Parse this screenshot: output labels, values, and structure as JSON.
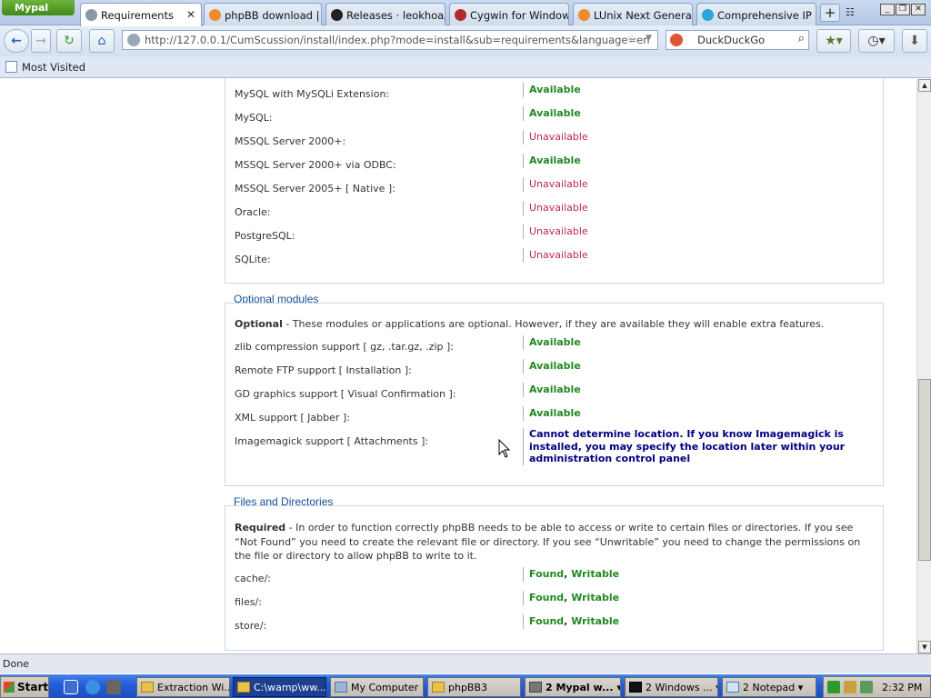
{
  "browser": {
    "app_button": "Mypal",
    "tabs": [
      {
        "label": "Requirements",
        "active": true,
        "icon": "globe-icon"
      },
      {
        "label": "phpBB download | S...",
        "icon": "phpbb-icon"
      },
      {
        "label": "Releases · leokhoa/l...",
        "icon": "github-icon"
      },
      {
        "label": "Cygwin for Windows...",
        "icon": "cygwin-icon"
      },
      {
        "label": "LUnix Next Generati...",
        "icon": "phpbb-icon"
      },
      {
        "label": "Comprehensive IP a...",
        "icon": "location-icon"
      }
    ],
    "new_tab": "+",
    "url": "http://127.0.0.1/CumScussion/install/index.php?mode=install&sub=requirements&language=en",
    "search_placeholder": "DuckDuckGo",
    "bookmarks_label": "Most Visited",
    "status": "Done"
  },
  "page": {
    "db_rows": [
      {
        "label": "MySQL with MySQLi Extension:",
        "value": "Available",
        "status": "ok"
      },
      {
        "label": "MySQL:",
        "value": "Available",
        "status": "ok"
      },
      {
        "label": "MSSQL Server 2000+:",
        "value": "Unavailable",
        "status": "bad"
      },
      {
        "label": "MSSQL Server 2000+ via ODBC:",
        "value": "Available",
        "status": "ok"
      },
      {
        "label": "MSSQL Server 2005+ [ Native ]:",
        "value": "Unavailable",
        "status": "bad"
      },
      {
        "label": "Oracle:",
        "value": "Unavailable",
        "status": "bad"
      },
      {
        "label": "PostgreSQL:",
        "value": "Unavailable",
        "status": "bad"
      },
      {
        "label": "SQLite:",
        "value": "Unavailable",
        "status": "bad"
      }
    ],
    "optional": {
      "title": "Optional modules",
      "desc_bold": "Optional",
      "desc_text": " - These modules or applications are optional. However, if they are available they will enable extra features.",
      "rows": [
        {
          "label": "zlib compression support [ gz, .tar.gz, .zip ]:",
          "value": "Available",
          "status": "ok"
        },
        {
          "label": "Remote FTP support [ Installation ]:",
          "value": "Available",
          "status": "ok"
        },
        {
          "label": "GD graphics support [ Visual Confirmation ]:",
          "value": "Available",
          "status": "ok"
        },
        {
          "label": "XML support [ Jabber ]:",
          "value": "Available",
          "status": "ok"
        },
        {
          "label": "Imagemagick support [ Attachments ]:",
          "value": "Cannot determine location. If you know Imagemagick is installed, you may specify the location later within your administration control panel",
          "status": "note"
        }
      ]
    },
    "files": {
      "title": "Files and Directories",
      "desc_bold": "Required",
      "desc_text": " - In order to function correctly phpBB needs to be able to access or write to certain files or directories. If you see “Not Found” you need to create the relevant file or directory. If you see “Unwritable” you need to change the permissions on the file or directory to allow phpBB to write to it.",
      "rows": [
        {
          "label": "cache/:",
          "found": "Found",
          "sep": ", ",
          "writable": "Writable"
        },
        {
          "label": "files/:",
          "found": "Found",
          "sep": ", ",
          "writable": "Writable"
        },
        {
          "label": "store/:",
          "found": "Found",
          "sep": ", ",
          "writable": "Writable"
        }
      ]
    }
  },
  "taskbar": {
    "start": "Start",
    "buttons": [
      {
        "label": "Extraction Wi..."
      },
      {
        "label": "C:\\wamp\\ww...",
        "active": true
      },
      {
        "label": "My Computer"
      },
      {
        "label": "phpBB3"
      },
      {
        "label": "2 Mypal w..."
      },
      {
        "label": "2 Windows ..."
      },
      {
        "label": "2 Notepad"
      }
    ],
    "clock": "2:32 PM"
  },
  "colors": {
    "available": "#228822",
    "unavailable": "#bc2a4d",
    "note": "#000080",
    "legend": "#115098"
  }
}
